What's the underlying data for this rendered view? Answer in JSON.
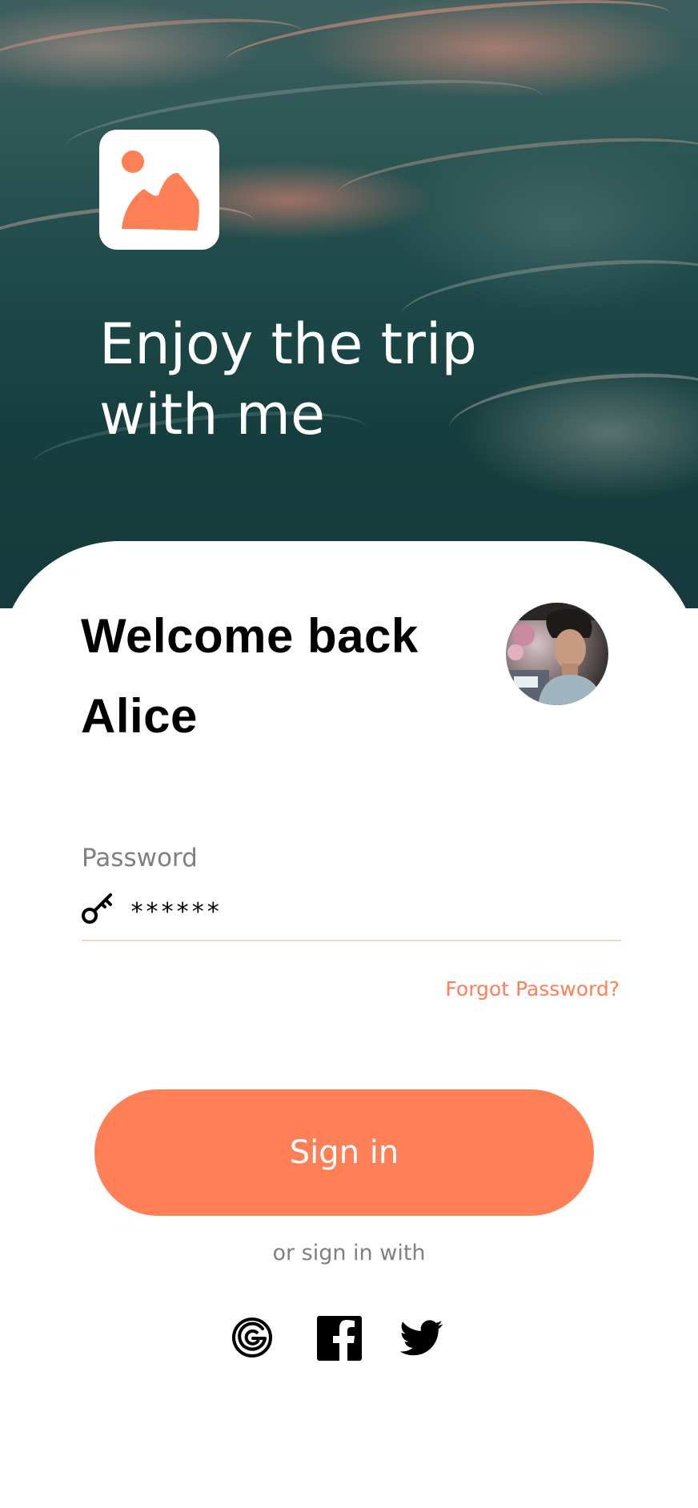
{
  "hero": {
    "title": "Enjoy the trip\nwith me",
    "logo_icon": "image-icon"
  },
  "welcome": {
    "line1": "Welcome back",
    "line2": "Alice",
    "avatar_icon": "profile-photo"
  },
  "password": {
    "label": "Password",
    "value": "******",
    "icon": "key-icon"
  },
  "forgot_password": "Forgot Password?",
  "sign_in_button": "Sign in",
  "alt_sign_in_text": "or sign in with",
  "social": [
    {
      "name": "google",
      "icon": "google-icon"
    },
    {
      "name": "facebook",
      "icon": "facebook-icon"
    },
    {
      "name": "twitter",
      "icon": "twitter-icon"
    }
  ],
  "colors": {
    "accent": "#ff7f57",
    "muted_text": "#808080",
    "ocean": "#1f4a4a",
    "underline": "#f5d6ca"
  }
}
